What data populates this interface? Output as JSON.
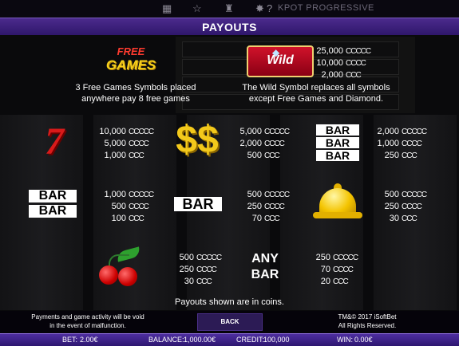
{
  "top": {
    "icons": [
      "menu-grid-icon",
      "star-icon",
      "trophy-icon",
      "cross-icon",
      "help-icon"
    ],
    "label": "KPOT PROGRESSIVE"
  },
  "header": {
    "title": "PAYOUTS"
  },
  "freegames": {
    "symbol_line1": "FREE",
    "symbol_line2": "GAMES",
    "desc_line1": "3 Free Games Symbols placed",
    "desc_line2": "anywhere pay 8 free games"
  },
  "wild": {
    "symbol": "Wild",
    "desc_line1": "The Wild Symbol replaces all symbols",
    "desc_line2": "except Free Games and Diamond.",
    "pays": [
      {
        "n": "25,000",
        "c": "CCCCC"
      },
      {
        "n": "10,000",
        "c": "CCCC"
      },
      {
        "n": "2,000",
        "c": "CCC"
      }
    ]
  },
  "sevens": {
    "pays": [
      {
        "n": "10,000",
        "c": "CCCCC"
      },
      {
        "n": "5,000",
        "c": "CCCC"
      },
      {
        "n": "1,000",
        "c": "CCC"
      }
    ]
  },
  "dollar": {
    "symbol": "$$",
    "pays": [
      {
        "n": "5,000",
        "c": "CCCCC"
      },
      {
        "n": "2,000",
        "c": "CCCC"
      },
      {
        "n": "500",
        "c": "CCC"
      }
    ]
  },
  "triplebar": {
    "label": "BAR",
    "pays": [
      {
        "n": "2,000",
        "c": "CCCCC"
      },
      {
        "n": "1,000",
        "c": "CCCC"
      },
      {
        "n": "250",
        "c": "CCC"
      }
    ]
  },
  "doublebar": {
    "label": "BAR",
    "pays": [
      {
        "n": "1,000",
        "c": "CCCCC"
      },
      {
        "n": "500",
        "c": "CCCC"
      },
      {
        "n": "100",
        "c": "CCC"
      }
    ]
  },
  "singlebar": {
    "label": "BAR",
    "pays": [
      {
        "n": "500",
        "c": "CCCCC"
      },
      {
        "n": "250",
        "c": "CCCC"
      },
      {
        "n": "70",
        "c": "CCC"
      }
    ]
  },
  "bell": {
    "pays": [
      {
        "n": "500",
        "c": "CCCCC"
      },
      {
        "n": "250",
        "c": "CCCC"
      },
      {
        "n": "30",
        "c": "CCC"
      }
    ]
  },
  "cherry": {
    "pays": [
      {
        "n": "500",
        "c": "CCCCC"
      },
      {
        "n": "250",
        "c": "CCCC"
      },
      {
        "n": "30",
        "c": "CCC"
      }
    ]
  },
  "anybar": {
    "line1": "ANY",
    "line2": "BAR",
    "pays": [
      {
        "n": "250",
        "c": "CCCCC"
      },
      {
        "n": "70",
        "c": "CCCC"
      },
      {
        "n": "20",
        "c": "CCC"
      }
    ]
  },
  "note": "Payouts shown are in coins.",
  "footer": {
    "left_line1": "Payments and game activity will be void",
    "left_line2": "in the event of malfunction.",
    "back": "BACK",
    "right_line1": "TM&© 2017 iSoftBet",
    "right_line2": "All Rights Reserved."
  },
  "status": {
    "bet_label": "BET:",
    "bet": "2.00€",
    "balance_label": "BALANCE:",
    "balance": "1,000.00€",
    "credit_label": "CREDIT:",
    "credit": "100,000",
    "win_label": "WIN:",
    "win": "0.00€"
  },
  "colors": {
    "header": "#4b2a8c",
    "gold": "#f3c91b",
    "red": "#d91a1a"
  }
}
